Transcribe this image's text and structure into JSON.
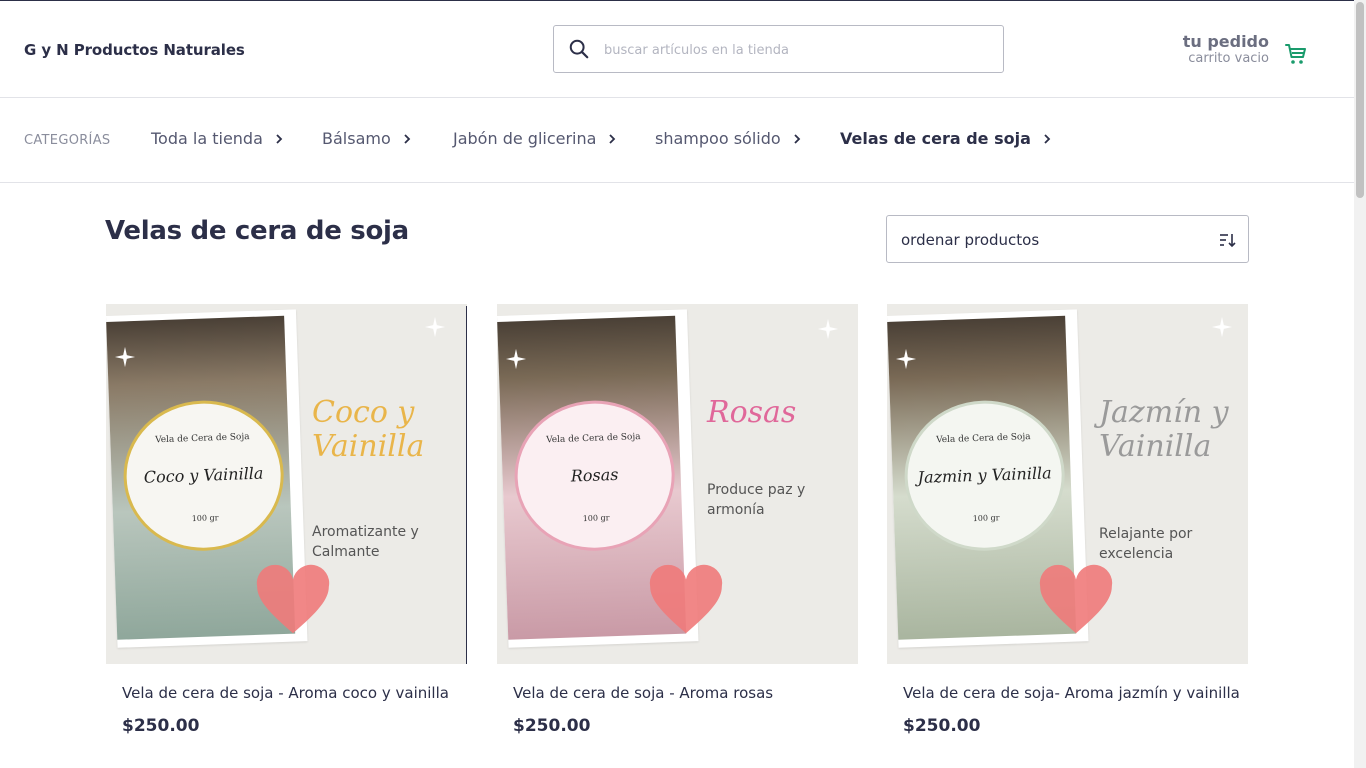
{
  "header": {
    "brand": "G y N Productos Naturales",
    "search_placeholder": "buscar artículos en la tienda",
    "cart_title": "tu pedido",
    "cart_status": "carrito vacio"
  },
  "categories": {
    "label": "CATEGORÍAS",
    "items": [
      {
        "label": "Toda la tienda"
      },
      {
        "label": "Bálsamo"
      },
      {
        "label": "Jabón de glicerina"
      },
      {
        "label": "shampoo sólido"
      },
      {
        "label": "Velas de cera de soja"
      }
    ],
    "active": "Velas de cera de soja"
  },
  "page": {
    "title": "Velas de cera de soja",
    "sort_label": "ordenar productos"
  },
  "products": [
    {
      "title": "Vela de cera de soja - Aroma coco y vainilla",
      "price": "$250.00",
      "image": {
        "script": "Coco y Vainilla",
        "description": "Aromatizante y Calmante",
        "label_top": "Vela de Cera de Soja",
        "label_script": "Coco y Vainilla",
        "label_weight": "100 gr",
        "accent": "#e9b54a"
      }
    },
    {
      "title": "Vela de cera de soja - Aroma rosas",
      "price": "$250.00",
      "image": {
        "script": "Rosas",
        "description": "Produce paz y armonía",
        "label_top": "Vela de Cera de Soja",
        "label_script": "Rosas",
        "label_weight": "100 gr",
        "accent": "#e0689a"
      }
    },
    {
      "title": "Vela de cera de soja- Aroma jazmín y vainilla",
      "price": "$250.00",
      "image": {
        "script": "Jazmín y Vainilla",
        "description": "Relajante por excelencia",
        "label_top": "Vela de Cera de Soja",
        "label_script": "Jazmin y Vainilla",
        "label_weight": "100 gr",
        "accent": "#9a9a9a"
      }
    }
  ],
  "colors": {
    "text": "#2c2f48",
    "cart_icon": "#1a9b6c",
    "heart": "#ef7a7a"
  }
}
